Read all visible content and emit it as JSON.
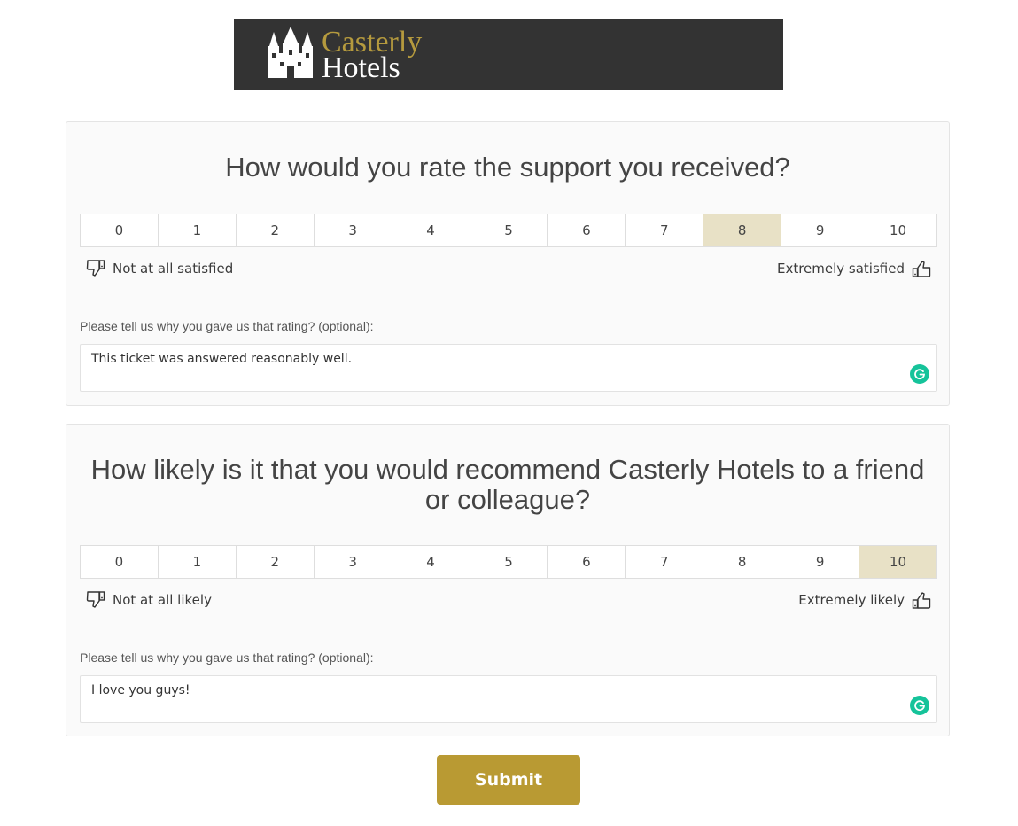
{
  "brand": {
    "line1": "Casterly",
    "line2": "Hotels",
    "colors": {
      "banner": "#333333",
      "gold": "#b59a3e",
      "white": "#ffffff"
    },
    "icon": "castle-icon"
  },
  "questions": [
    {
      "title": "How would you rate the support you received?",
      "scale": [
        "0",
        "1",
        "2",
        "3",
        "4",
        "5",
        "6",
        "7",
        "8",
        "9",
        "10"
      ],
      "selected": 8,
      "low_label": "Not at all satisfied",
      "high_label": "Extremely satisfied",
      "low_icon": "thumbs-down-icon",
      "high_icon": "thumbs-up-icon",
      "comment_prompt": "Please tell us why you gave us that rating? (optional):",
      "comment_value": "This ticket was answered reasonably well."
    },
    {
      "title": "How likely is it that you would recommend Casterly Hotels to a friend or colleague?",
      "scale": [
        "0",
        "1",
        "2",
        "3",
        "4",
        "5",
        "6",
        "7",
        "8",
        "9",
        "10"
      ],
      "selected": 10,
      "low_label": "Not at all likely",
      "high_label": "Extremely likely",
      "low_icon": "thumbs-down-icon",
      "high_icon": "thumbs-up-icon",
      "comment_prompt": "Please tell us why you gave us that rating? (optional):",
      "comment_value": "I love you guys!"
    }
  ],
  "submit_label": "Submit",
  "colors": {
    "selected_cell": "#e8e1c6",
    "submit_button": "#b99a33",
    "grammarly": "#15c39a"
  }
}
